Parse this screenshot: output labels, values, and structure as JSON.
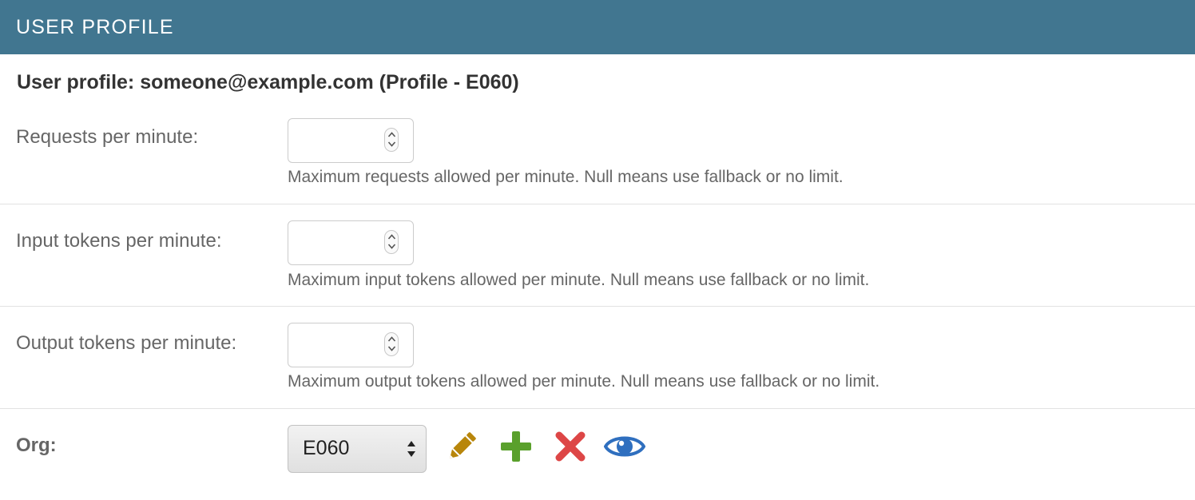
{
  "header": {
    "title": "USER PROFILE"
  },
  "subtitle": "User profile: someone@example.com (Profile - E060)",
  "fields": [
    {
      "label": "Requests per minute:",
      "value": "",
      "help": "Maximum requests allowed per minute. Null means use fallback or no limit."
    },
    {
      "label": "Input tokens per minute:",
      "value": "",
      "help": "Maximum input tokens allowed per minute. Null means use fallback or no limit."
    },
    {
      "label": "Output tokens per minute:",
      "value": "",
      "help": "Maximum output tokens allowed per minute. Null means use fallback or no limit."
    }
  ],
  "org": {
    "label": "Org:",
    "selected": "E060",
    "actions": [
      {
        "icon": "pencil-icon",
        "color": "#b8860b"
      },
      {
        "icon": "plus-icon",
        "color": "#5aa02c"
      },
      {
        "icon": "close-icon",
        "color": "#dd4646"
      },
      {
        "icon": "eye-icon",
        "color": "#2f6fbf"
      }
    ]
  },
  "colors": {
    "header_bg": "#417690",
    "header_text": "#ffffff"
  }
}
